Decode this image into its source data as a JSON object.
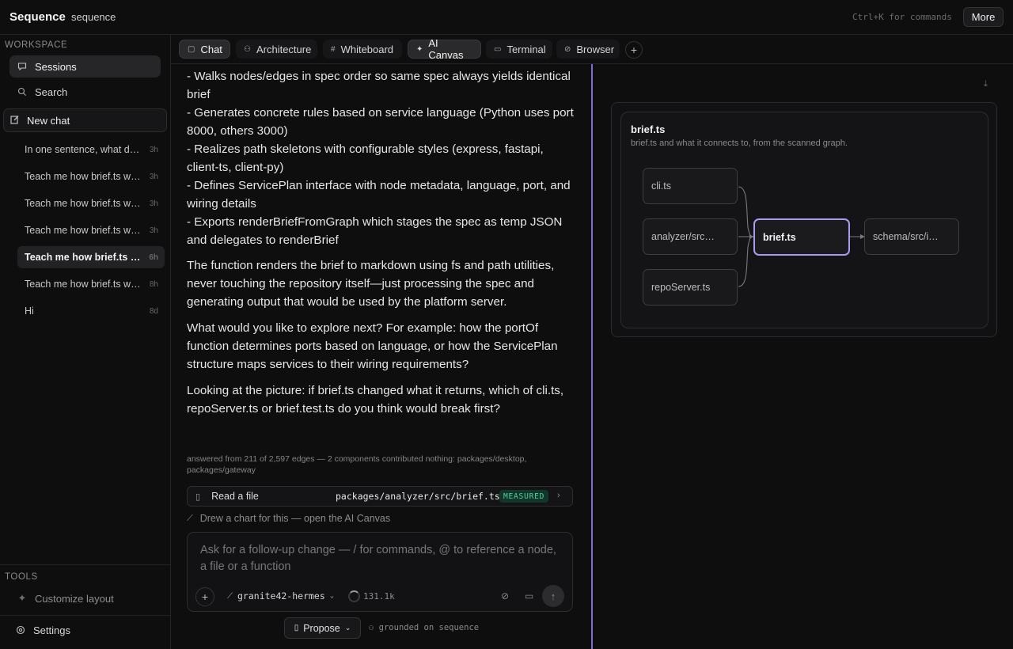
{
  "app": {
    "brand": "Sequence",
    "project": "sequence",
    "command_hint": "Ctrl+K for commands",
    "more_label": "More"
  },
  "sidebar": {
    "workspace_label": "WORKSPACE",
    "nav": [
      {
        "label": "Sessions",
        "icon": "chat-bubble-icon",
        "active": true
      },
      {
        "label": "Search",
        "icon": "search-icon",
        "active": false
      }
    ],
    "new_chat_label": "New chat",
    "sessions": [
      {
        "title": "In one sentence, what do…",
        "age": "3h",
        "active": false
      },
      {
        "title": "Teach me how brief.ts wo…",
        "age": "3h",
        "active": false
      },
      {
        "title": "Teach me how brief.ts wo…",
        "age": "3h",
        "active": false
      },
      {
        "title": "Teach me how brief.ts wo…",
        "age": "3h",
        "active": false
      },
      {
        "title": "Teach me how brief.ts wo…",
        "age": "6h",
        "active": true
      },
      {
        "title": "Teach me how brief.ts wo…",
        "age": "8h",
        "active": false
      },
      {
        "title": "Hi",
        "age": "8d",
        "active": false
      }
    ],
    "tools_label": "TOOLS",
    "customize_label": "Customize layout",
    "settings_label": "Settings"
  },
  "tabs": [
    {
      "label": "Chat",
      "icon": "chat-icon",
      "active": true
    },
    {
      "label": "Architecture",
      "icon": "architecture-icon",
      "active": false
    },
    {
      "label": "Whiteboard",
      "icon": "hash-icon",
      "active": false
    },
    {
      "label": "AI Canvas",
      "icon": "sparkle-icon",
      "active": true
    },
    {
      "label": "Terminal",
      "icon": "terminal-icon",
      "active": false
    },
    {
      "label": "Browser",
      "icon": "link-icon",
      "active": false
    }
  ],
  "chat": {
    "paragraphs": [
      "- Walks nodes/edges in spec order so same spec always yields identical brief\n- Generates concrete rules based on service language (Python uses port 8000, others 3000)\n- Realizes path skeletons with configurable styles (express, fastapi, client-ts, client-py)\n- Defines ServicePlan interface with node metadata, language, port, and wiring details\n- Exports renderBriefFromGraph which stages the spec as temp JSON and delegates to renderBrief",
      "The function renders the brief to markdown using fs and path utilities, never touching the repository itself—just processing the spec and generating output that would be used by the platform server.",
      "What would you like to explore next? For example: how the portOf function determines ports based on language, or how the ServicePlan structure maps services to their wiring requirements?",
      "Looking at the picture: if brief.ts changed what it returns, which of cli.ts, repoServer.ts or brief.test.ts do you think would break first?"
    ],
    "meta_note": "answered from 211 of 2,597 edges — 2 components contributed nothing: packages/desktop, packages/gateway",
    "tool_call": {
      "label": "Read a file",
      "path": "packages/analyzer/src/brief.ts",
      "badge": "MEASURED"
    },
    "canvas_link": "Drew a chart for this — open the AI Canvas",
    "composer": {
      "placeholder": "Ask for a follow-up change — / for commands, @ to reference a node, a file or a function",
      "model": "granite42-hermes",
      "tokens": "131.1k"
    },
    "propose_label": "Propose",
    "grounded_label": "grounded on sequence"
  },
  "canvas": {
    "title": "brief.ts",
    "subtitle": "brief.ts and what it connects to, from the scanned graph.",
    "nodes": {
      "cli": "cli.ts",
      "analyzer": "analyzer/src…",
      "repo": "repoServer.ts",
      "brief": "brief.ts",
      "schema": "schema/src/i…"
    }
  }
}
